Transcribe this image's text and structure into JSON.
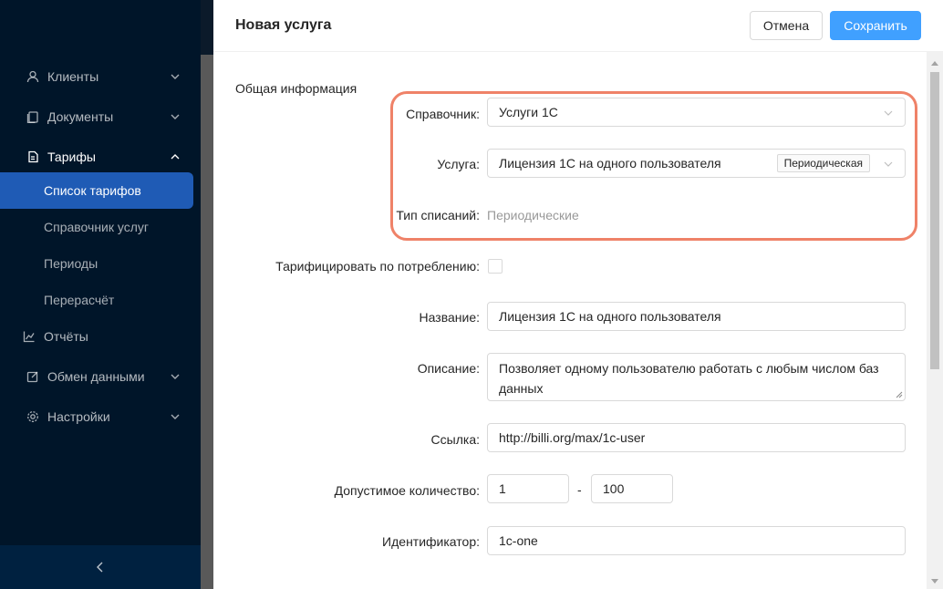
{
  "sidebar": {
    "items": [
      {
        "label": "Клиенты",
        "icon": "user-icon"
      },
      {
        "label": "Документы",
        "icon": "documents-icon"
      },
      {
        "label": "Тарифы",
        "icon": "tariffs-icon"
      },
      {
        "label": "Отчёты",
        "icon": "chart-icon"
      },
      {
        "label": "Обмен данными",
        "icon": "exchange-icon"
      },
      {
        "label": "Настройки",
        "icon": "gear-icon"
      }
    ],
    "subitems": [
      {
        "label": "Список тарифов",
        "active": true
      },
      {
        "label": "Справочник услуг"
      },
      {
        "label": "Периоды"
      },
      {
        "label": "Перерасчёт"
      }
    ],
    "colors": {
      "bg": "#001529",
      "active": "#1f5bb5"
    }
  },
  "drawer": {
    "title": "Новая услуга",
    "cancel_label": "Отмена",
    "save_label": "Сохранить",
    "section": "Общая информация"
  },
  "form": {
    "directory": {
      "label": "Справочник:",
      "value": "Услуги 1С"
    },
    "service": {
      "label": "Услуга:",
      "value": "Лицензия 1С на одного пользователя",
      "tag": "Периодическая"
    },
    "charge_type": {
      "label": "Тип списаний:",
      "value": "Периодические"
    },
    "consumption": {
      "label": "Тарифицировать по потреблению:",
      "checked": false
    },
    "name": {
      "label": "Название:",
      "value": "Лицензия 1С на одного пользователя"
    },
    "description": {
      "label": "Описание:",
      "value": "Позволяет одному пользователю работать с любым числом баз данных"
    },
    "link": {
      "label": "Ссылка:",
      "value": "http://billi.org/max/1c-user"
    },
    "quantity": {
      "label": "Допустимое количество:",
      "min": "1",
      "separator": "-",
      "max": "100"
    },
    "identifier": {
      "label": "Идентификатор:",
      "value": "1c-one"
    }
  },
  "accent": "#40a0ff",
  "highlight_color": "#ef8268"
}
